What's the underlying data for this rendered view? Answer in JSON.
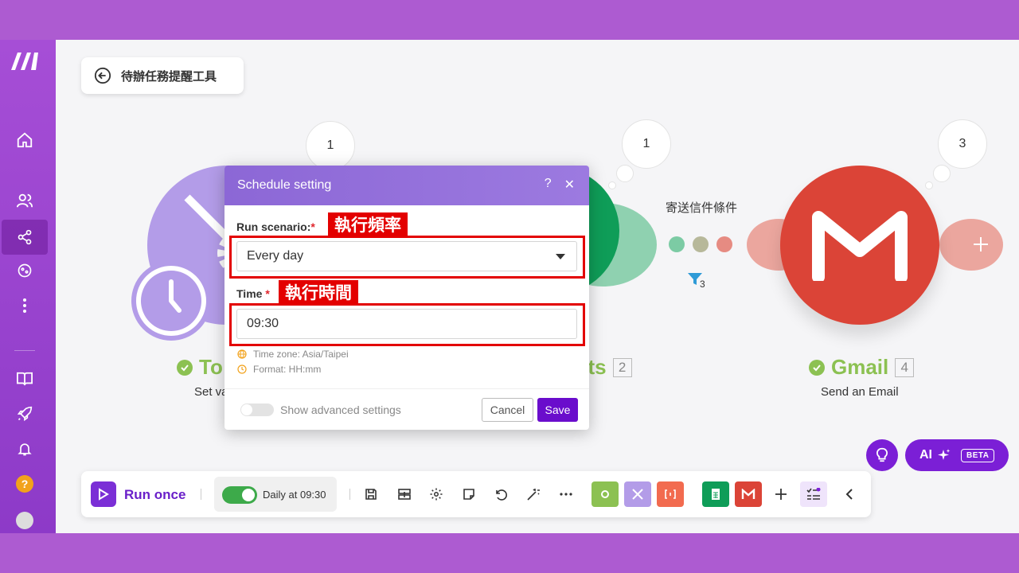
{
  "scenario": {
    "title": "待辦任務提醒工具"
  },
  "nodes": {
    "tools": {
      "label_partial": "To",
      "sub_partial": "Set va",
      "bubble_count": "1"
    },
    "sheets": {
      "label_partial": "ets",
      "number": "2",
      "bubble_count": "1"
    },
    "gmail": {
      "label": "Gmail",
      "number": "4",
      "sub": "Send an Email",
      "bubble_count": "3"
    }
  },
  "filter": {
    "label": "寄送信件條件",
    "count": "3"
  },
  "modal": {
    "title": "Schedule setting",
    "help": "?",
    "close": "✕",
    "run_label": "Run scenario:",
    "run_annotation": "執行頻率",
    "run_value": "Every day",
    "time_label": "Time",
    "time_annotation": "執行時間",
    "time_value": "09:30",
    "timezone_hint": "Time zone: Asia/Taipei",
    "format_hint": "Format: HH:mm",
    "advanced_label": "Show advanced settings",
    "cancel": "Cancel",
    "save": "Save",
    "required_mark": "*"
  },
  "toolbar": {
    "run_once": "Run once",
    "schedule": "Daily at 09:30"
  },
  "ai": {
    "label": "AI",
    "badge": "BETA"
  },
  "colors": {
    "brand_purple": "#6a0dcc",
    "gmail_red": "#db4437",
    "sheets_green": "#0f9d58",
    "tools_purple": "#b8a2ea",
    "annotation_red": "#e30000"
  }
}
